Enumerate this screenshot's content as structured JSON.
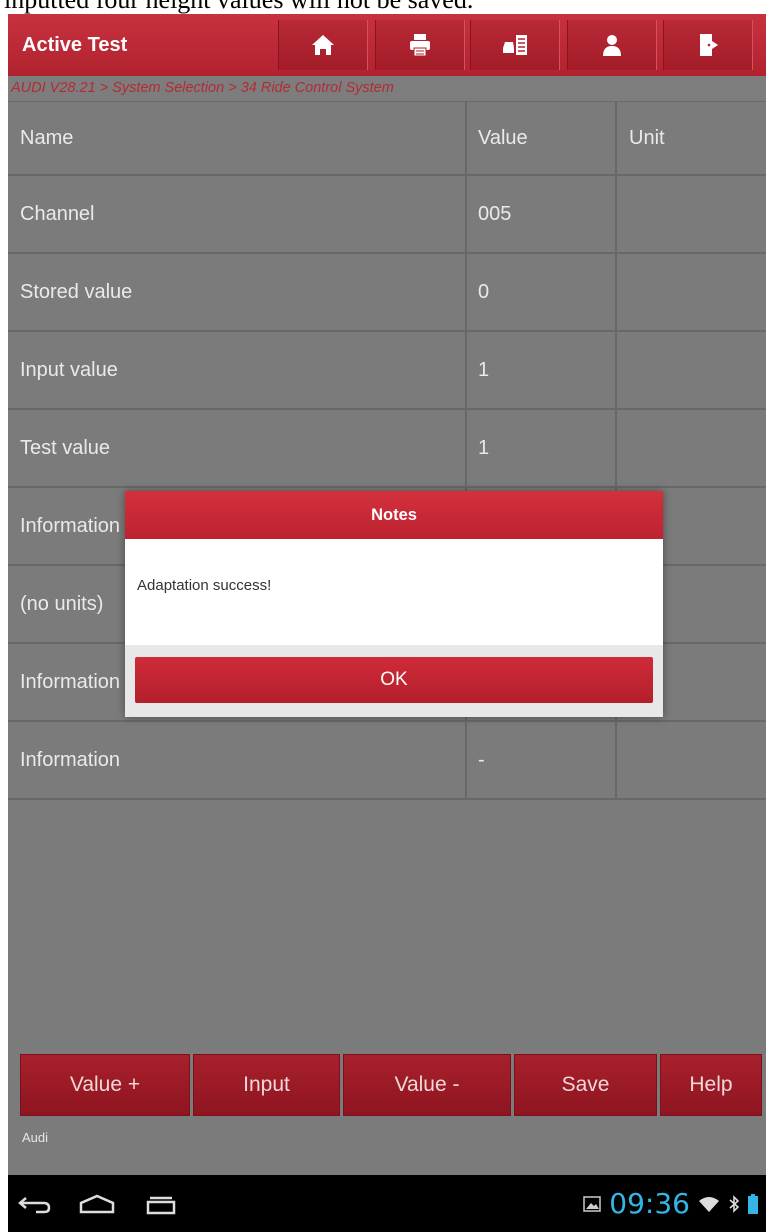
{
  "caption": "inputted four height values will not be saved.",
  "header": {
    "title": "Active Test",
    "icons": [
      "home-icon",
      "print-icon",
      "car-list-icon",
      "user-icon",
      "exit-icon"
    ]
  },
  "breadcrumb": "AUDI V28.21 > System Selection > 34 Ride Control System",
  "table": {
    "columns": [
      "Name",
      "Value",
      "Unit"
    ],
    "rows": [
      {
        "name": "Channel",
        "value": "005",
        "unit": ""
      },
      {
        "name": "Stored value",
        "value": "0",
        "unit": ""
      },
      {
        "name": "Input value",
        "value": "1",
        "unit": ""
      },
      {
        "name": "Test value",
        "value": "1",
        "unit": ""
      },
      {
        "name": "Information",
        "value": "",
        "unit": ""
      },
      {
        "name": "(no units)",
        "value": "",
        "unit": ""
      },
      {
        "name": "Information",
        "value": "",
        "unit": ""
      },
      {
        "name": "Information",
        "value": "-",
        "unit": ""
      }
    ]
  },
  "buttons": {
    "value_plus": "Value +",
    "input": "Input",
    "value_minus": "Value -",
    "save": "Save",
    "help": "Help"
  },
  "footer": {
    "make": "Audi"
  },
  "dialog": {
    "title": "Notes",
    "message": "Adaptation success!",
    "ok": "OK"
  },
  "system": {
    "time": "09:36"
  },
  "colors": {
    "accent": "#c0222f",
    "clock": "#33b5e5",
    "background": "#7b7b7b"
  }
}
